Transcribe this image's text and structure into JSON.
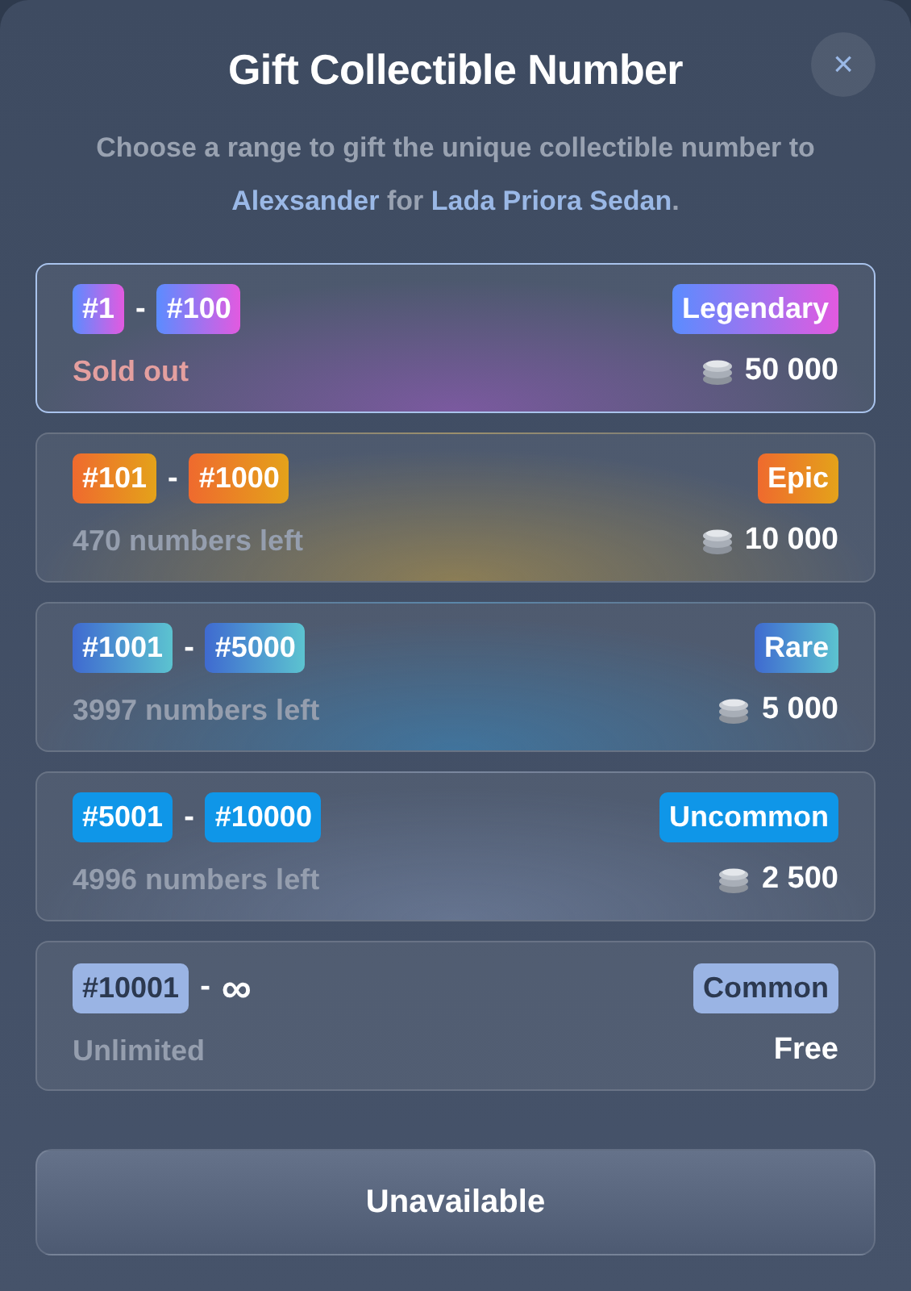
{
  "dialog": {
    "title": "Gift Collectible Number",
    "close": "×",
    "subtitle": [
      {
        "text": "Choose a range to gift the unique collectible number to ",
        "highlight": false
      },
      {
        "text": "Alexsander",
        "highlight": true
      },
      {
        "text": " for ",
        "highlight": false
      },
      {
        "text": "Lada Priora Sedan",
        "highlight": true
      },
      {
        "text": ".",
        "highlight": false
      }
    ]
  },
  "tiers": [
    {
      "kind": "legendary",
      "from": "#1",
      "separator": "-",
      "to": "#100",
      "rarity": "Legendary",
      "status": "Sold out",
      "sold_out": true,
      "price": "50 000",
      "coin": true,
      "selected": true
    },
    {
      "kind": "epic",
      "from": "#101",
      "separator": "-",
      "to": "#1000",
      "rarity": "Epic",
      "status": "470 numbers left",
      "sold_out": false,
      "price": "10 000",
      "coin": true,
      "selected": false
    },
    {
      "kind": "rare",
      "from": "#1001",
      "separator": "-",
      "to": "#5000",
      "rarity": "Rare",
      "status": "3997 numbers left",
      "sold_out": false,
      "price": "5 000",
      "coin": true,
      "selected": false
    },
    {
      "kind": "uncommon",
      "from": "#5001",
      "separator": "-",
      "to": "#10000",
      "rarity": "Uncommon",
      "status": "4996 numbers left",
      "sold_out": false,
      "price": "2 500",
      "coin": true,
      "selected": false
    },
    {
      "kind": "common",
      "from": "#10001",
      "separator": "-",
      "to": "∞",
      "rarity": "Common",
      "status": "Unlimited",
      "sold_out": false,
      "price": "Free",
      "coin": false,
      "selected": false
    }
  ],
  "action": {
    "label": "Unavailable",
    "disabled": true
  }
}
